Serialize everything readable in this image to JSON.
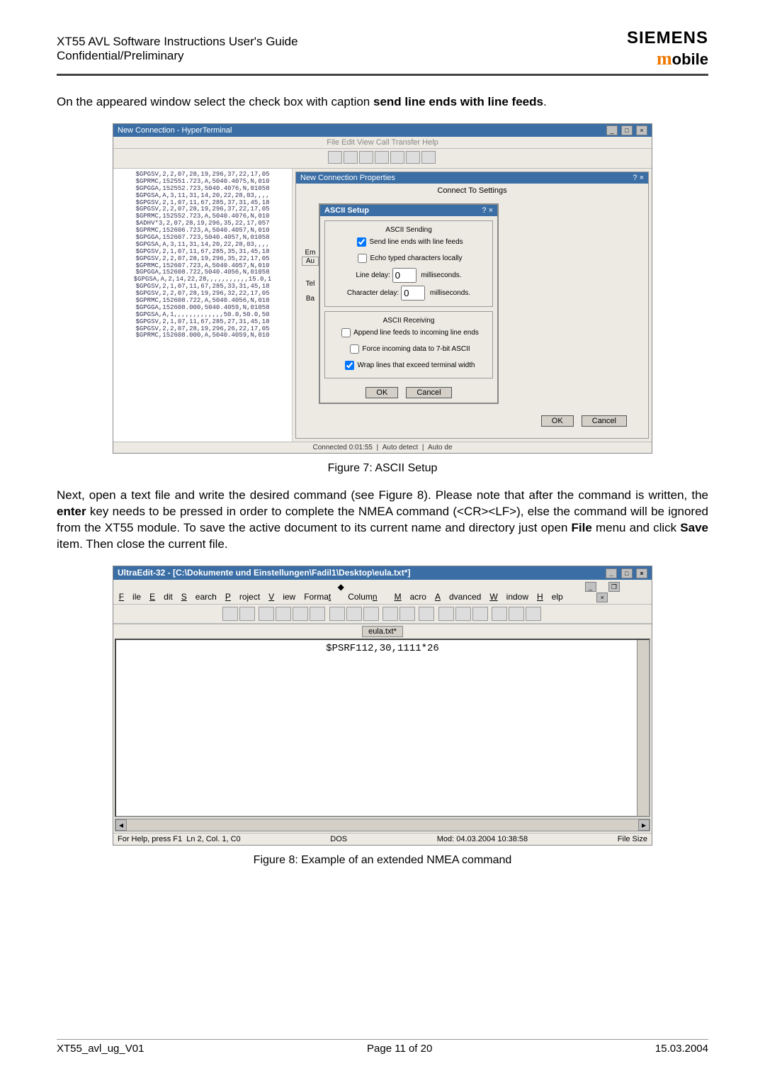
{
  "header": {
    "title_line1": "XT55 AVL Software Instructions User's Guide",
    "title_line2": "Confidential/Preliminary",
    "logo_top": "SIEMENS",
    "logo_bottom_m": "m",
    "logo_bottom_rest": "obile"
  },
  "intro": "On the appeared window select the check box with caption send line ends with line feeds.",
  "shot1": {
    "window_title": "New Connection - HyperTerminal",
    "menubar": "File  Edit  View  Call  Transfer  Help",
    "terminal_text": "$GPGSV,2,2,07,28,19,296,37,22,17,05\n$GPRMC,152551.723,A,5040.4075,N,010\n$GPGGA,152552.723,5040.4076,N,01058\n$GPGSA,A,3,11,31,14,20,22,28,03,,,,\n$GPGSV,2,1,07,11,67,285,37,31,45,18\n$GPGSV,2,2,07,28,19,296,37,22,17,05\n$GPRMC,152552.723,A,5040.4076,N,010\n$ADHV*3,2,07,28,19,296,35,22,17,057\n$GPRMC,152606.723,A,5040.4057,N,010\n$GPGGA,152607.723,5040.4057,N,01058\n$GPGSA,A,3,11,31,14,20,22,28,03,,,,\n$GPGSV,2,1,07,11,67,285,35,31,45,18\n$GPGSV,2,2,07,28,19,296,35,22,17,05\n$GPRMC,152607.723,A,5040.4057,N,010\n$GPGGA,152608.722,5040.4056,N,01058\n$GPGSA,A,2,14,22,28,,,,,,,,,,,15.0,1\n$GPGSV,2,1,07,11,67,285,33,31,45,18\n$GPGSV,2,2,07,28,19,296,32,22,17,05\n$GPRMC,152608.722,A,5040.4056,N,010\n$GPGGA,152608.000,5040.4059,N,01058\n$GPGSA,A,1,,,,,,,,,,,,,50.0,50.0,50\n$GPGSV,2,1,07,11,67,285,27,31,45,18\n$GPGSV,2,2,07,28,19,296,26,22,17,05\n$GPRMC,152608.000,A,5040.4059,N,010",
    "prop_title": "New Connection Properties",
    "prop_tabs": "Connect To   Settings",
    "ascii_title": "ASCII Setup",
    "grp_send": "ASCII Sending",
    "chk_send_line_ends": "Send line ends with line feeds",
    "chk_echo": "Echo typed characters locally",
    "line_delay_label": "Line delay:",
    "line_delay_val": "0",
    "line_delay_unit": "milliseconds.",
    "char_delay_label": "Character delay:",
    "char_delay_val": "0",
    "char_delay_unit": "milliseconds.",
    "grp_recv": "ASCII Receiving",
    "chk_append": "Append line feeds to incoming line ends",
    "chk_force7": "Force incoming data to 7-bit ASCII",
    "chk_wrap": "Wrap lines that exceed terminal width",
    "ok": "OK",
    "cancel": "Cancel",
    "status_left": "Connected 0:01:55",
    "status_mid1": "Auto detect",
    "status_mid2": "Auto de",
    "side_labels": {
      "em": "Em",
      "au": "Au",
      "tel": "Tel",
      "ba": "Ba"
    }
  },
  "fig1_caption": "Figure 7: ASCII Setup",
  "mid_para": "Next, open a text file and write the desired command (see Figure 8). Please note that after the command is written, the enter key needs to be pressed in order to complete the NMEA command (<CR><LF>), else the command will be ignored from the XT55 module. To save the active document to its current name and directory just open File menu and click Save item. Then close the current file.",
  "shot2": {
    "title": "UltraEdit-32 - [C:\\Dokumente und Einstellungen\\Fadil1\\Desktop\\eula.txt*]",
    "menu": [
      "File",
      "Edit",
      "Search",
      "Project",
      "View",
      "Format",
      "Column",
      "Macro",
      "Advanced",
      "Window",
      "Help"
    ],
    "tab": "eula.txt*",
    "editor_text": "$PSRF112,30,1111*26",
    "status_left": "For Help, press F1",
    "status_pos": "Ln 2, Col. 1, C0",
    "status_dos": "DOS",
    "status_mod": "Mod: 04.03.2004 10:38:58",
    "status_fsize": "File Size"
  },
  "fig2_caption": "Figure 8: Example of an extended NMEA command",
  "footer": {
    "left": "XT55_avl_ug_V01",
    "mid": "Page 11 of 20",
    "right": "15.03.2004"
  }
}
